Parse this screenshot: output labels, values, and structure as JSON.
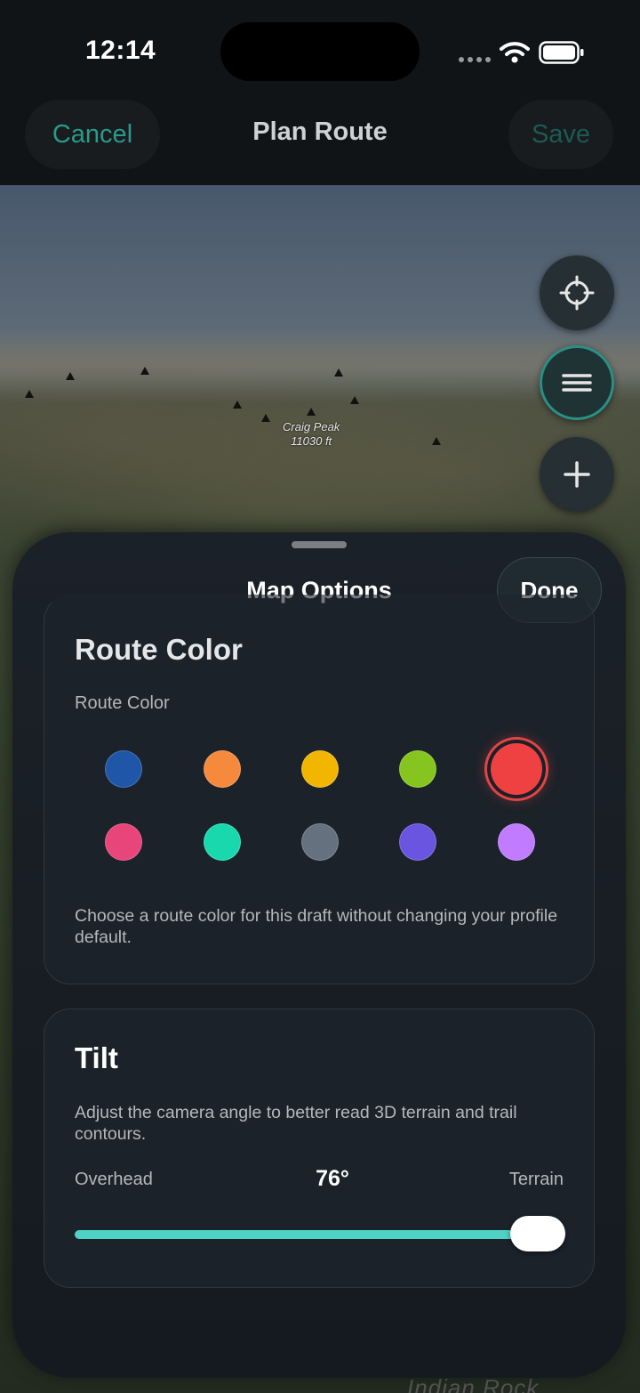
{
  "status_bar": {
    "time": "12:14"
  },
  "nav": {
    "cancel_label": "Cancel",
    "title": "Plan Route",
    "save_label": "Save"
  },
  "map": {
    "peak_name": "Craig Peak",
    "peak_elevation": "11030 ft",
    "bottom_label": "Indian Rock",
    "buttons": [
      "crosshair-icon",
      "menu-icon",
      "plus-icon"
    ]
  },
  "sheet": {
    "title": "Map Options",
    "done_label": "Done",
    "route_color": {
      "heading": "Route Color",
      "subheading": "Route Color",
      "colors": [
        "#1f56a8",
        "#f58a3c",
        "#f2b500",
        "#86c51f",
        "#ef4141",
        "#e8457a",
        "#1ad8ae",
        "#65717e",
        "#6a55e0",
        "#c07bff"
      ],
      "selected_index": 4,
      "help": "Choose a route color for this draft without changing your profile default."
    },
    "tilt": {
      "heading": "Tilt",
      "description": "Adjust the camera angle to better read 3D terrain and trail contours.",
      "min_label": "Overhead",
      "value": "76°",
      "max_label": "Terrain",
      "slider_fraction": 0.95,
      "accent": "#4fd1c5"
    }
  }
}
